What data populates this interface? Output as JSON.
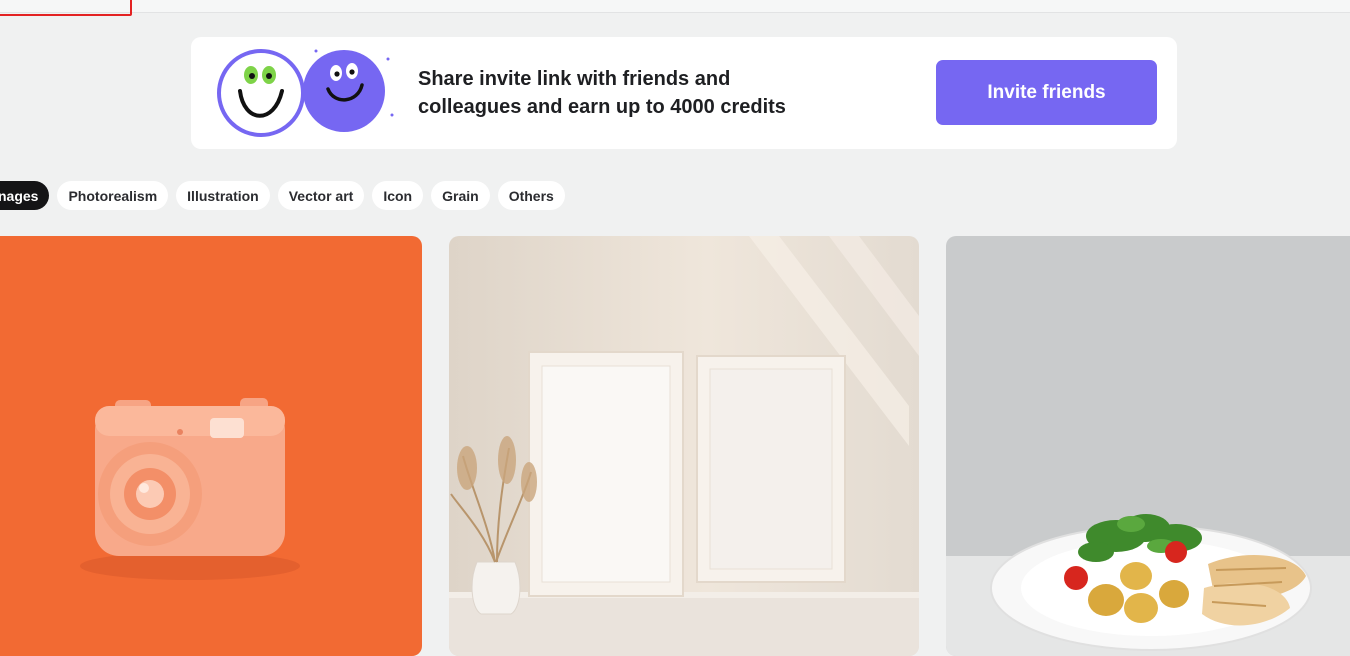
{
  "banner": {
    "text_line1": "Share invite link with friends and",
    "text_line2": "colleagues and earn up to 4000 credits",
    "button_label": "Invite friends"
  },
  "filters": [
    {
      "label": "Images",
      "visible_text": "nages",
      "active": true
    },
    {
      "label": "Photorealism"
    },
    {
      "label": "Illustration"
    },
    {
      "label": "Vector art"
    },
    {
      "label": "Icon"
    },
    {
      "label": "Grain"
    },
    {
      "label": "Others"
    }
  ],
  "colors": {
    "accent": "#7667f2",
    "card1_bg": "#f26a33",
    "active_chip": "#141416"
  }
}
